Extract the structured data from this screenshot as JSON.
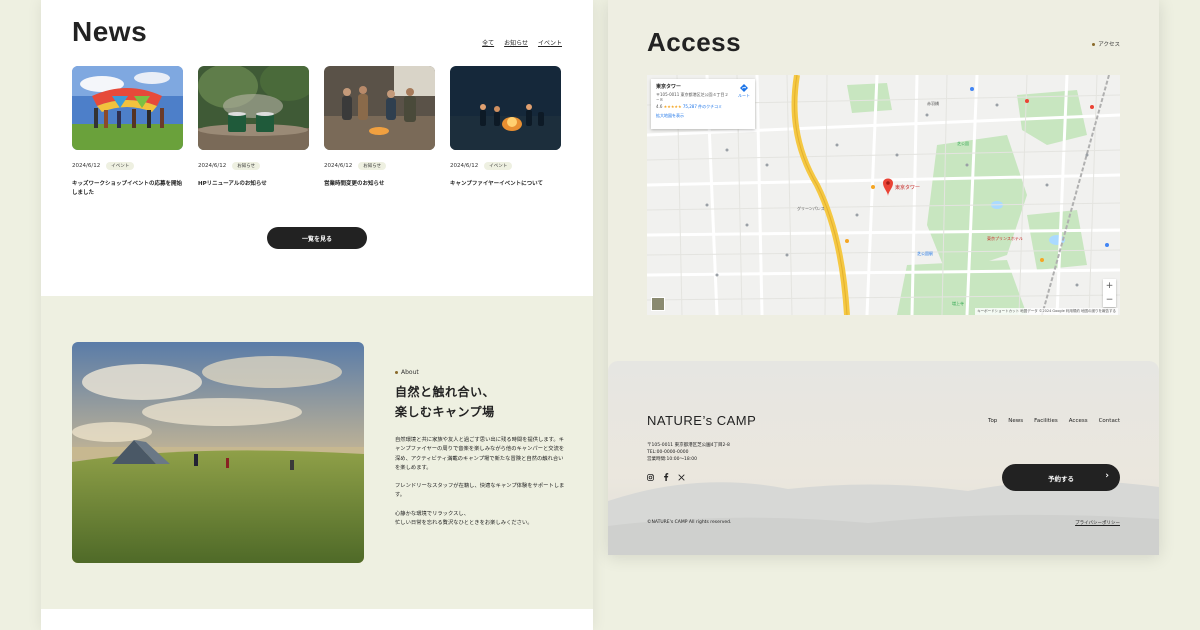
{
  "news": {
    "title": "News",
    "filters": [
      "全て",
      "お知らせ",
      "イベント"
    ],
    "items": [
      {
        "date": "2024/6/12",
        "tag": "イベント",
        "title": "キッズワークショップイベントの応募を開始しました"
      },
      {
        "date": "2024/6/12",
        "tag": "お知らせ",
        "title": "HPリニューアルのお知らせ"
      },
      {
        "date": "2024/6/12",
        "tag": "お知らせ",
        "title": "営業時間変更のお知らせ"
      },
      {
        "date": "2024/6/12",
        "tag": "イベント",
        "title": "キャンプファイヤーイベントについて"
      }
    ],
    "more_label": "一覧を見る"
  },
  "about": {
    "label": "About",
    "heading_line1": "自然と触れ合い、",
    "heading_line2": "楽しむキャンプ場",
    "paragraph1": "自然環境と共に家族や友人と過ごす思い出に残る時間を提供します。キャンプファイヤーの周りで音楽を楽しみながら他のキャンパーと交流を深め、アクティビティ満載のキャンプ場で新たな冒険と自然の触れ合いを楽しめます。",
    "paragraph2": "フレンドリーなスタッフが在籍し、快適なキャンプ体験をサポートします。",
    "paragraph3_line1": "心静かな環境でリラックスし、",
    "paragraph3_line2": "忙しい日常を忘れる贅沢なひとときをお楽しみください。"
  },
  "access": {
    "title": "Access",
    "label": "アクセス",
    "map": {
      "place_name": "東京タワー",
      "address": "〒105-0011 東京都港区芝公園４丁目２−８",
      "rating": "4.6",
      "stars": "★★★★★",
      "reviews": "75,287 件のクチコミ",
      "route_label": "ルート",
      "enlarge_label": "拡大地図を表示",
      "zoom_in": "+",
      "zoom_out": "−",
      "attribution": "キーボードショートカット  地図データ ©2024 Google  利用規約  地図の誤りを報告する",
      "labels": [
        "東京タワー",
        "芝公園",
        "東京プリンスホテル",
        "増上寺",
        "グリーンパレス",
        "赤羽橋",
        "芝公園駅"
      ]
    }
  },
  "footer": {
    "logo": "NATURE’s  CAMP",
    "nav": [
      "Top",
      "News",
      "Facilities",
      "Access",
      "Contact"
    ],
    "address": "〒105-0011 東京都港区芝公園4丁目2-8",
    "tel": "TEL:00-0000-0000",
    "hours": "営業時間:10:00〜18:00",
    "social_icons": [
      "instagram-icon",
      "facebook-icon",
      "x-icon"
    ],
    "reserve_label": "予約する",
    "reserve_arrow": "›",
    "copyright": "©NATURE's CAMP All rights reserved.",
    "privacy": "プライバシーポリシー"
  },
  "colors": {
    "background": "#eef0e1",
    "dark": "#222222",
    "accent": "#8a6a2a",
    "map_water": "#aadaff",
    "map_park": "#c8e6c0",
    "map_road": "#f5c842",
    "map_pin": "#ea4335"
  }
}
